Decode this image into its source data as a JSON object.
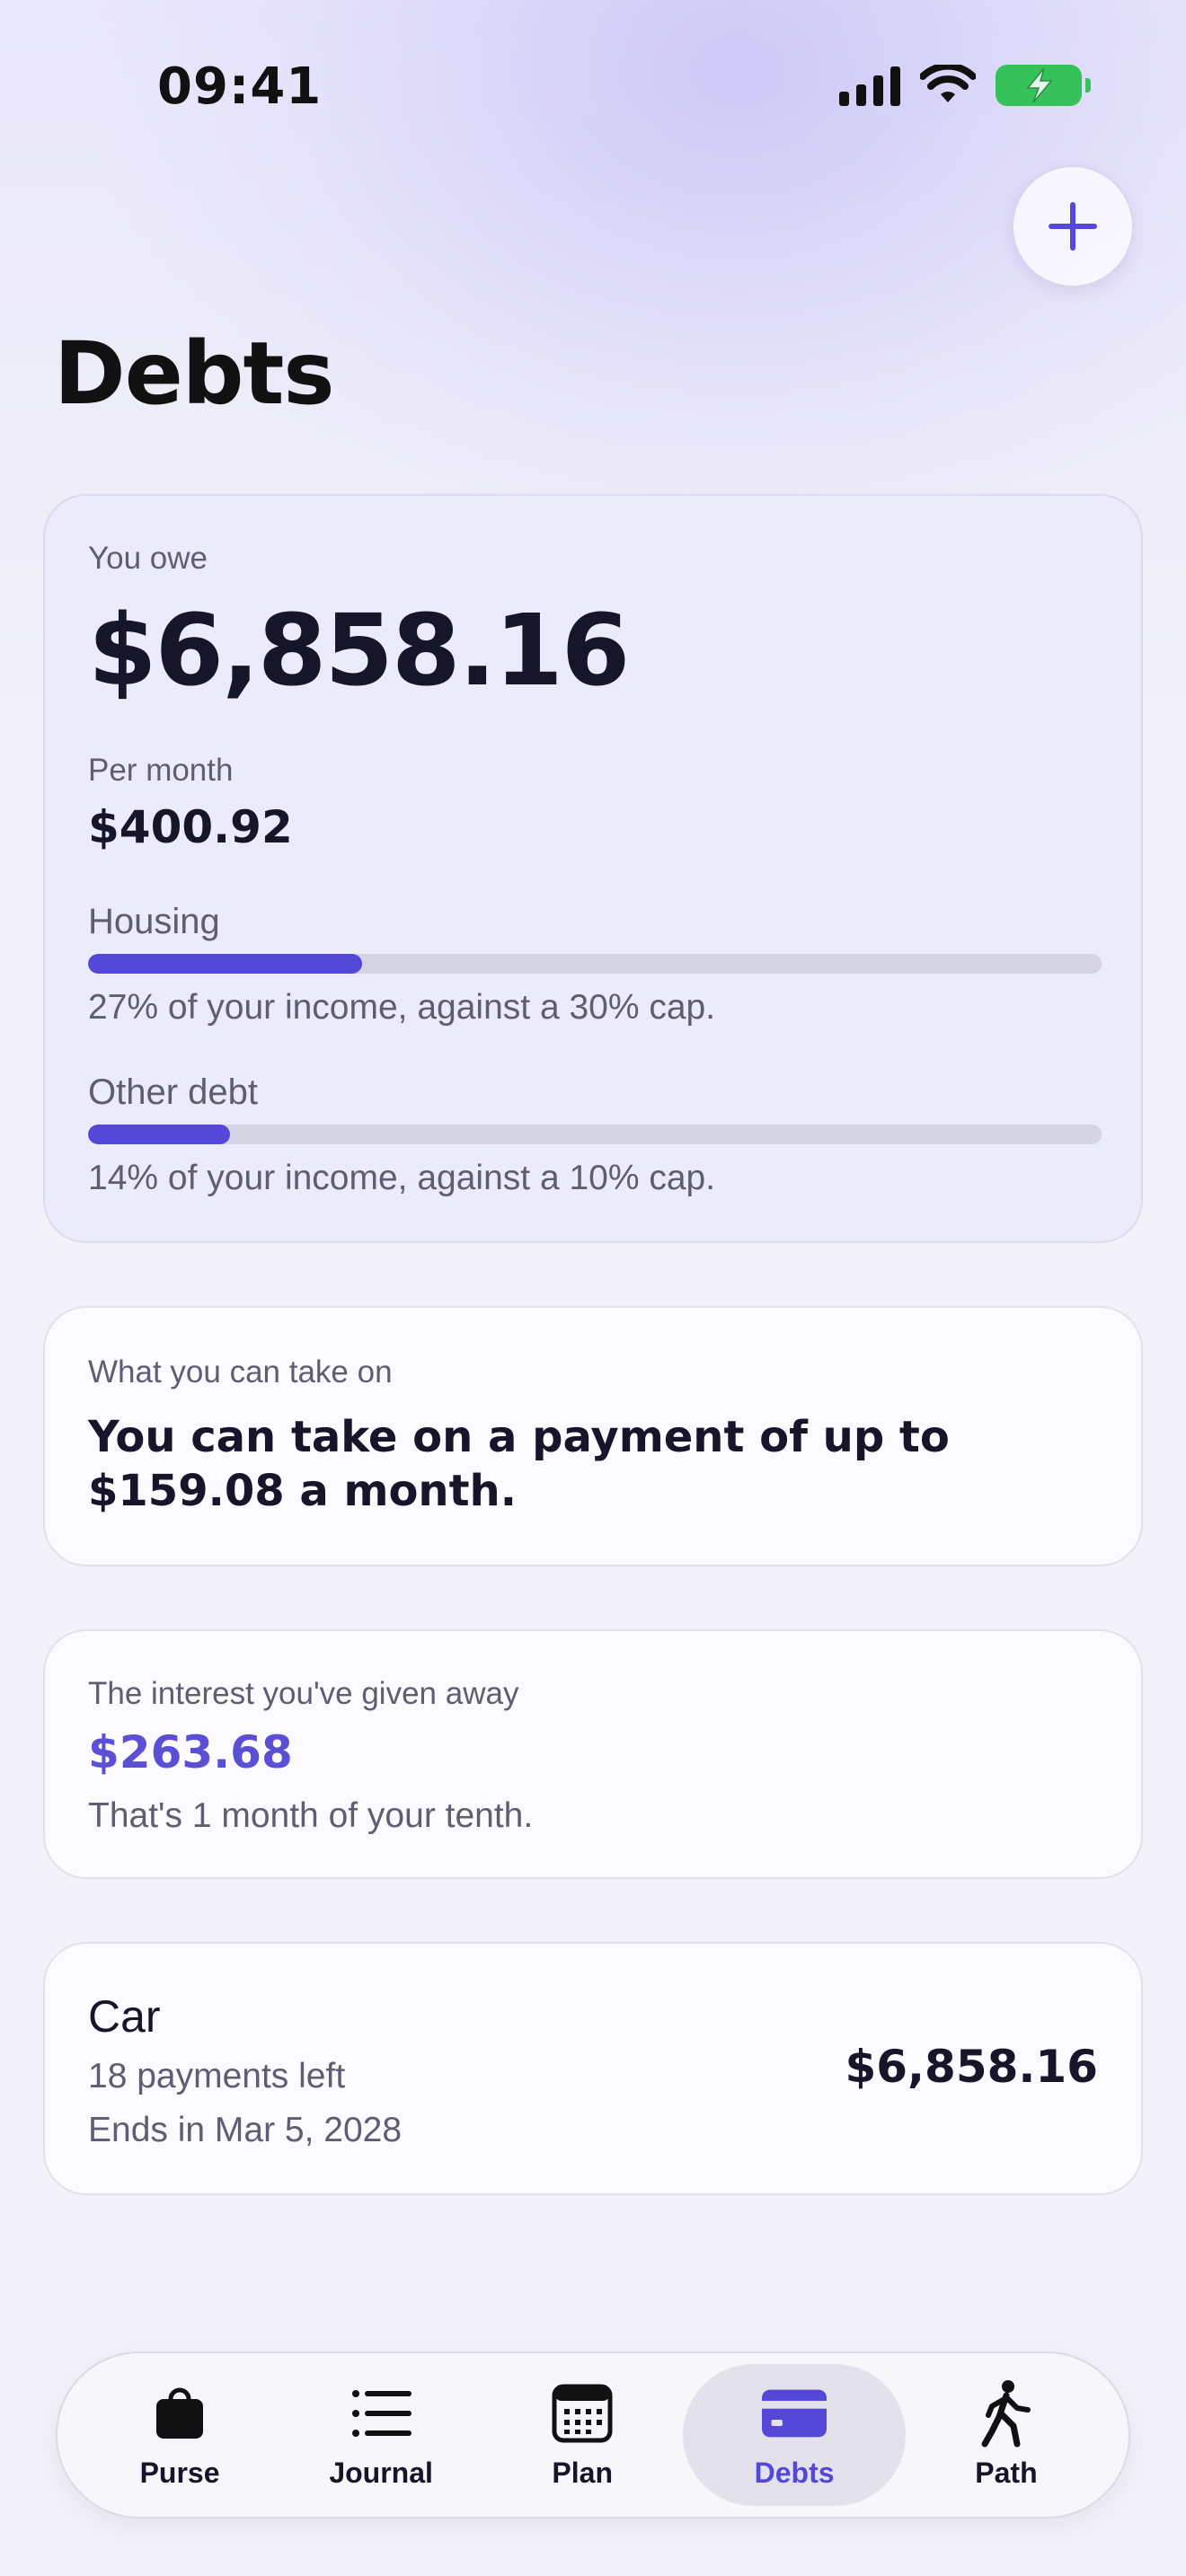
{
  "status_bar": {
    "time": "09:41"
  },
  "header": {
    "title": "Debts",
    "add_icon": "plus-icon"
  },
  "summary": {
    "owe_label": "You owe",
    "owe_amount": "$6,858.16",
    "per_month_label": "Per month",
    "per_month_amount": "$400.92",
    "bars": [
      {
        "label": "Housing",
        "value_percent": 27,
        "note": "27% of your income, against a 30% cap."
      },
      {
        "label": "Other debt",
        "value_percent": 14,
        "note": "14% of your income, against a 10% cap."
      }
    ]
  },
  "capacity": {
    "title": "What you can take on",
    "text": "You can take on a payment of up to $159.08 a month."
  },
  "interest": {
    "title": "The interest you've given away",
    "amount": "$263.68",
    "note": "That's 1 month of your tenth."
  },
  "loans": [
    {
      "name": "Car",
      "payments_left": "18 payments left",
      "ends": "Ends in Mar 5, 2028",
      "amount": "$6,858.16"
    }
  ],
  "tabs": [
    {
      "label": "Purse",
      "icon": "bag-icon",
      "active": false
    },
    {
      "label": "Journal",
      "icon": "list-icon",
      "active": false
    },
    {
      "label": "Plan",
      "icon": "calendar-icon",
      "active": false
    },
    {
      "label": "Debts",
      "icon": "credit-card-icon",
      "active": true
    },
    {
      "label": "Path",
      "icon": "walking-person-icon",
      "active": false
    }
  ],
  "colors": {
    "accent": "#5548d8",
    "battery": "#36c25a",
    "track": "#d5d4e2"
  }
}
